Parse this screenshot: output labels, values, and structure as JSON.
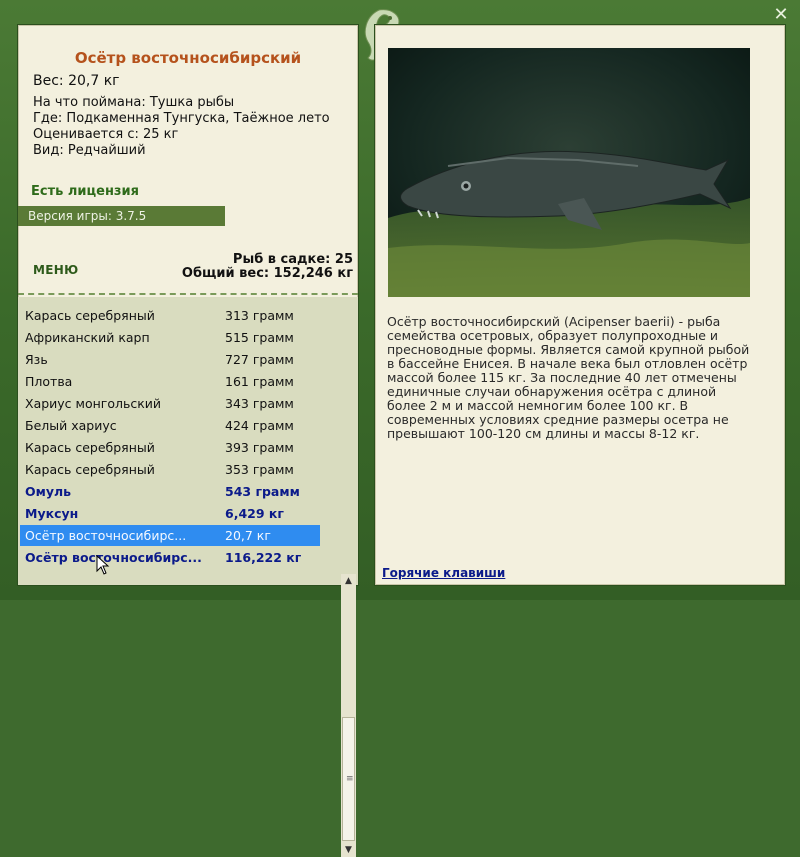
{
  "window": {
    "close_icon": "close-icon",
    "logo_icon": "fish-logo-icon"
  },
  "fish": {
    "title": "Осётр восточносибирский",
    "weight": "Вес: 20,7 кг",
    "caught_on": "На что поймана: Тушка рыбы",
    "where": "Где: Подкаменная Тунгуска, Таёжное лето",
    "valued_from": "Оценивается с: 25 кг",
    "kind": "Вид: Редчайший",
    "license": "Есть лицензия"
  },
  "version": "Версия игры: 3.7.5",
  "menu_label": "МЕНЮ",
  "stats": {
    "fish_in_keepnet": "Рыб в садке: 25",
    "total_weight": "Общий вес: 152,246 кг"
  },
  "catch_list": [
    {
      "name": "Карась серебряный",
      "weight": "313 грамм",
      "style": "normal"
    },
    {
      "name": "Африканский карп",
      "weight": "515 грамм",
      "style": "normal"
    },
    {
      "name": "Язь",
      "weight": "727 грамм",
      "style": "normal"
    },
    {
      "name": "Плотва",
      "weight": "161 грамм",
      "style": "normal"
    },
    {
      "name": "Хариус монгольский",
      "weight": "343 грамм",
      "style": "normal"
    },
    {
      "name": "Белый хариус",
      "weight": "424 грамм",
      "style": "normal"
    },
    {
      "name": "Карась серебряный",
      "weight": "393 грамм",
      "style": "normal"
    },
    {
      "name": "Карась серебряный",
      "weight": "353 грамм",
      "style": "normal"
    },
    {
      "name": "Омуль",
      "weight": "543 грамм",
      "style": "bold"
    },
    {
      "name": "Муксун",
      "weight": "6,429 кг",
      "style": "bold"
    },
    {
      "name": "Осётр восточносибирс...",
      "weight": "20,7 кг",
      "style": "selected"
    },
    {
      "name": "Осётр восточносибирс...",
      "weight": "116,222 кг",
      "style": "bold"
    }
  ],
  "description": "Осётр восточносибирский (Acipenser baerii) - рыба семейства осетровых, образует полупроходные и пресноводные формы. Является самой крупной рыбой в бассейне Енисея. В начале века был отловлен осётр массой более 115 кг. За последние 40 лет отмечены единичные случаи обнаружения осётра с длиной более 2 м и массой немногим более 100 кг. В современных условиях средние размеры осетра не превышают 100-120 см длины и массы 8-12 кг.",
  "hotkeys_label": "Горячие клавиши",
  "colors": {
    "frame": "#3e6a2e",
    "panel": "#f3f0de",
    "title": "#b5521c",
    "bold_row": "#0b1a8a",
    "selected_row": "#2f8cf0"
  }
}
